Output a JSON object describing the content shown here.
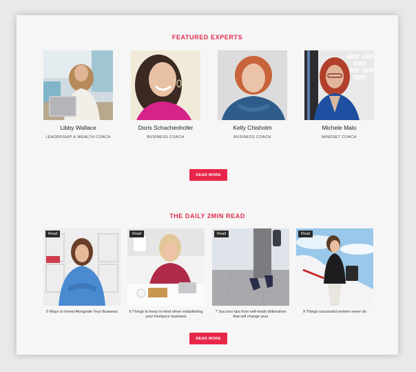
{
  "featured": {
    "title": "FEATURED EXPERTS",
    "experts": [
      {
        "name": "Libby Wallace",
        "role": "LEADERSHIP & WEALTH COACH"
      },
      {
        "name": "Doris Schachenhofer",
        "role": "BUSINESS COACH"
      },
      {
        "name": "Kelly Chisholm",
        "role": "BUSINESS COACH"
      },
      {
        "name": "Michele Malo",
        "role": "MINDSET COACH"
      }
    ],
    "read_more": "READ MORE"
  },
  "daily": {
    "title": "THE DAILY 2MIN READ",
    "posts": [
      {
        "badge": "Read",
        "title": "5 Ways to Invest Alongside Your Business"
      },
      {
        "badge": "Read",
        "title": "6 Things to keep in mind when establishing your freelance business"
      },
      {
        "badge": "Read",
        "title": "7 Success tips from self-made billionaires that will change your"
      },
      {
        "badge": "Read",
        "title": "9 Things successful women never do"
      }
    ],
    "read_more": "READ MORE"
  }
}
